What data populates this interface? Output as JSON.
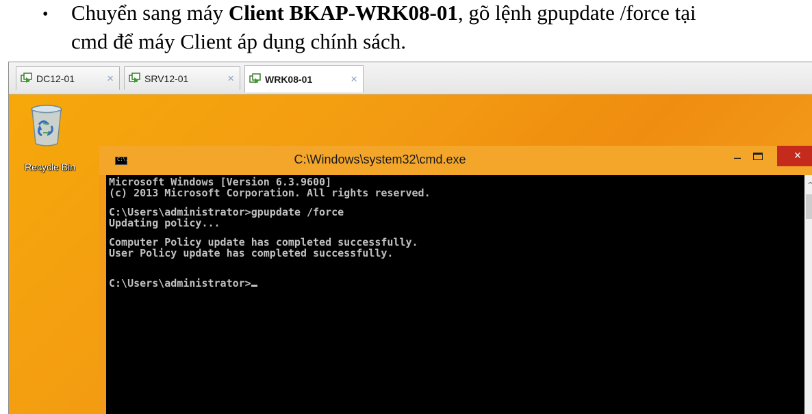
{
  "document": {
    "bullet": "•",
    "line1_prefix": "Chuyển sang máy ",
    "line1_bold": "Client BKAP-WRK08-01",
    "line1_suffix": ", gõ lệnh gpupdate /force tại",
    "line2": "cmd để máy Client áp dụng chính sách."
  },
  "tabs": [
    {
      "label": "DC12-01",
      "close": "×",
      "active": false
    },
    {
      "label": "SRV12-01",
      "close": "×",
      "active": false
    },
    {
      "label": "WRK08-01",
      "close": "×",
      "active": true
    }
  ],
  "desktop": {
    "recycle_bin_label": "Recycle Bin"
  },
  "cmd_window": {
    "title": "C:\\Windows\\system32\\cmd.exe",
    "icon_text": "C:\\.",
    "minimize": "–",
    "close": "×",
    "scroll_up": "^",
    "lines": {
      "l1": "Microsoft Windows [Version 6.3.9600]",
      "l2": "(c) 2013 Microsoft Corporation. All rights reserved.",
      "l3": "C:\\Users\\administrator>gpupdate /force",
      "l4": "Updating policy...",
      "l5": "Computer Policy update has completed successfully.",
      "l6": "User Policy update has completed successfully.",
      "l7": "C:\\Users\\administrator>"
    }
  },
  "colors": {
    "desktop_orange": "#f39c12",
    "console_bg": "#000000",
    "console_text": "#c0c0c0",
    "close_red": "#c42b1c"
  }
}
